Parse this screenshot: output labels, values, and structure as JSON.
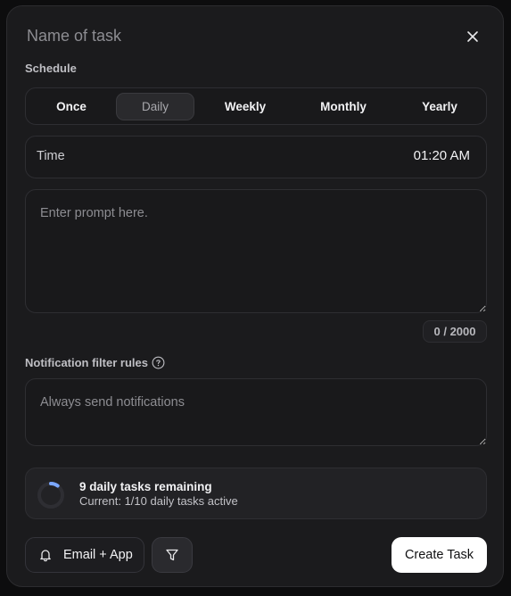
{
  "header": {
    "title_placeholder": "Name of task",
    "close_icon": "close-icon"
  },
  "schedule": {
    "label": "Schedule",
    "options": [
      "Once",
      "Daily",
      "Weekly",
      "Monthly",
      "Yearly"
    ],
    "selected": "Daily"
  },
  "time": {
    "label": "Time",
    "value": "01:20 AM"
  },
  "prompt": {
    "placeholder": "Enter prompt here.",
    "value": "",
    "counter": "0 / 2000"
  },
  "notification_filter": {
    "label": "Notification filter rules",
    "help_icon": "question-circle-icon",
    "placeholder": "Always send notifications",
    "value": ""
  },
  "tasks_status": {
    "title": "9 daily tasks remaining",
    "subtitle": "Current: 1/10 daily tasks active",
    "progress_fraction": 0.1,
    "accent_color": "#7ba7ff"
  },
  "footer": {
    "notify_label": "Email + App",
    "notify_icon": "bell-icon",
    "filter_icon": "funnel-icon",
    "create_label": "Create Task"
  }
}
